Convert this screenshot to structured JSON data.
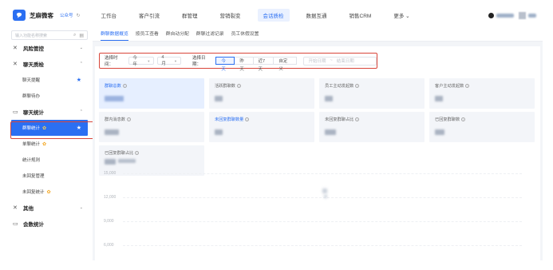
{
  "header": {
    "brand": "芝麻微客",
    "brand_sub": "公众号",
    "nav": [
      "工作台",
      "客户引流",
      "群管理",
      "营销裂变",
      "会话质检",
      "数据互通",
      "销售CRM",
      "更多 ⌄"
    ],
    "active_nav": 4
  },
  "sidebar": {
    "search_placeholder": "输入功能名称搜索",
    "groups": [
      {
        "label": "风险管控",
        "icon": "x-icon"
      },
      {
        "label": "聊天质检",
        "icon": "x-icon"
      },
      {
        "label": "聊天统计",
        "icon": "chat-icon"
      },
      {
        "label": "其他",
        "icon": "x-icon"
      },
      {
        "label": "会数统计",
        "icon": "chat-icon"
      }
    ],
    "items": [
      {
        "label": "聊天提醒"
      },
      {
        "label": "群聊待办"
      },
      {
        "label": "群聊统计"
      },
      {
        "label": "单聊统计"
      },
      {
        "label": "统计规则"
      },
      {
        "label": "未回复管理"
      },
      {
        "label": "未回复统计"
      }
    ]
  },
  "tabs": [
    "群聊数据概览",
    "按员工查看",
    "群自动分配",
    "群聊过滤记录",
    "员工休假设置"
  ],
  "filters": {
    "time_label": "选择时间：",
    "year": "今年",
    "month": "4月",
    "date_label": "选择日期：",
    "segments": [
      "今天",
      "昨天",
      "近7天",
      "自定义"
    ],
    "active_segment": 0,
    "start_placeholder": "开始日期",
    "end_placeholder": "结束日期",
    "range_sep": "~"
  },
  "cards": [
    {
      "title": "群聊总数",
      "highlight": true
    },
    {
      "title": "活跃群聊数",
      "highlight": false
    },
    {
      "title": "员工主动发起数",
      "highlight": false
    },
    {
      "title": "客户主动发起数",
      "highlight": false
    },
    {
      "title": "群内消息数",
      "highlight": false
    },
    {
      "title": "未回复群聊数量",
      "highlight": false
    },
    {
      "title": "未回复群聊占比",
      "highlight": false
    },
    {
      "title": "已回复群聊数",
      "highlight": false
    },
    {
      "title": "已回复群聊占比",
      "highlight": false
    }
  ],
  "chart": {
    "y_ticks": [
      "15,000",
      "12,000",
      "9,000",
      "6,000"
    ]
  }
}
